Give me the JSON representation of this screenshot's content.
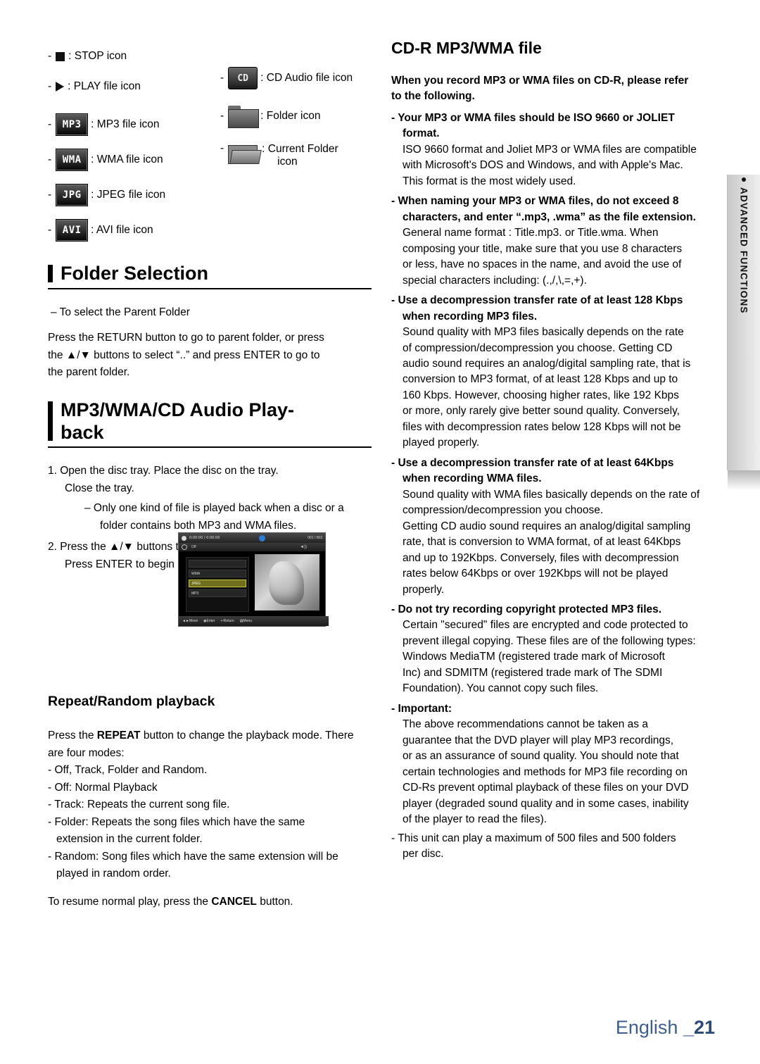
{
  "legend": {
    "items": [
      {
        "id": "stop",
        "icon": "stop-square-icon",
        "label": ": STOP icon"
      },
      {
        "id": "play",
        "icon": "play-triangle-icon",
        "label": ": PLAY file icon"
      },
      {
        "id": "mp3",
        "icon": "mp3-file-icon",
        "icon_text": "MP3",
        "label": ": MP3 file icon"
      },
      {
        "id": "wma",
        "icon": "wma-file-icon",
        "icon_text": "WMA",
        "label": ": WMA file icon"
      },
      {
        "id": "jpeg",
        "icon": "jpeg-file-icon",
        "icon_text": "JPG",
        "label": ": JPEG file icon"
      },
      {
        "id": "avi",
        "icon": "avi-file-icon",
        "icon_text": "AVI",
        "label": ": AVI file icon"
      },
      {
        "id": "cd",
        "icon": "cd-audio-file-icon",
        "icon_text": "CD",
        "label": ": CD Audio file icon"
      },
      {
        "id": "folder",
        "icon": "folder-icon",
        "label": ": Folder icon"
      },
      {
        "id": "current-folder",
        "icon": "current-folder-icon",
        "label": ": Current Folder",
        "label2": "icon"
      }
    ]
  },
  "folder_selection": {
    "title": "Folder Selection",
    "bullet": "–  To select the Parent Folder",
    "para_line1": "Press the RETURN button to go to parent folder, or press",
    "para_line2_a": "the ",
    "para_line2_b": " buttons to select “..” and press ENTER to go to",
    "para_line3": "the parent folder."
  },
  "playback": {
    "title_line1": "MP3/WMA/CD Audio Play-",
    "title_line2": "back",
    "step1_line1": "1.  Open the disc tray. Place the disc on the tray.",
    "step1_line2": "Close the tray.",
    "sub1_line1": "–   Only one kind of file is played back when a disc or a",
    "sub1_line2": "folder contains both MP3 and WMA files.",
    "step2_a": "2.  Press the ",
    "step2_b": " buttons to select a song file.",
    "step2_sub": "Press ENTER to begin playback of the song file."
  },
  "osd": {
    "time": "0:00:00 / 0:00:00",
    "track": "001 / 003",
    "off_label": "Off",
    "items": [
      "",
      "WMA",
      "JPEG",
      "MP3"
    ],
    "selected_index": 2,
    "footer": [
      "Move",
      "Enter",
      "Return",
      "Menu"
    ]
  },
  "repeat": {
    "title": "Repeat/Random playback",
    "p1_a": "Press the ",
    "p1_bold": "REPEAT",
    "p1_b": " button to change the playback mode. There",
    "p1_line2": "are four modes:",
    "modes": [
      "- Off, Track, Folder and Random.",
      "- Off: Normal Playback",
      "- Track: Repeats the current song file.",
      "- Folder: Repeats the song files which have the same",
      "extension in the current folder.",
      "- Random: Song files which have the same extension will be",
      "played in random order."
    ],
    "resume_a": "To resume normal play, press the ",
    "resume_bold": "CANCEL",
    "resume_b": " button."
  },
  "cdr": {
    "title": "CD-R MP3/WMA file",
    "intro_line1": "When you record MP3 or WMA files on CD-R, please refer",
    "intro_line2": "to the following.",
    "b1_line1": "- Your MP3 or WMA files should be ISO 9660 or JOLIET",
    "b1_line2": "format.",
    "b1_body": [
      "ISO 9660 format and Joliet MP3 or WMA files are compatible",
      "with Microsoft's DOS and Windows, and with Apple's Mac.",
      "This format is the most widely used."
    ],
    "b2_line1": "- When naming your MP3 or WMA files, do not exceed 8",
    "b2_line2": "characters, and enter “.mp3, .wma” as the file extension.",
    "b2_body": [
      "General name format : Title.mp3. or Title.wma. When",
      "composing your title, make sure that you use 8 characters",
      "or   less, have no spaces in the name, and avoid the use of",
      "special characters including: (.,/,\\,=,+)."
    ],
    "b3_line1": "- Use a decompression transfer rate of at least 128 Kbps",
    "b3_line2": "when recording MP3 files.",
    "b3_body": [
      "Sound quality with MP3 files basically depends on the rate",
      "of   compression/decompression you choose. Getting CD",
      "audio   sound requires an analog/digital sampling rate, that is",
      "conversion to MP3 format, of at least 128 Kbps and up to",
      "160   Kbps. However, choosing higher rates, like 192 Kbps",
      "or more,   only rarely give better sound quality. Conversely,",
      "files with   decompression rates below 128 Kbps will not be",
      "played     properly."
    ],
    "b4_line1": "- Use a decompression transfer rate of at least 64Kbps",
    "b4_line2": "when recording WMA files.",
    "b4_body": [
      "Sound quality with WMA files basically depends on the rate of",
      "compression/decompression you choose.",
      "Getting CD audio sound requires an analog/digital sampling",
      "rate, that is conversion to WMA format, of at least 64Kbps",
      "and up to 192Kbps. Conversely, files with decompression",
      "rates below 64Kbps or over 192Kbps will not be played",
      "properly."
    ],
    "b5_line1": "- Do not try recording copyright protected MP3 files.",
    "b5_body": [
      "Certain \"secured\" files are encrypted and code protected to",
      "prevent illegal copying. These files are of the following types:",
      "Windows MediaTM (registered trade mark of Microsoft",
      "Inc) and   SDMITM (registered trade mark of The SDMI",
      "Foundation). You cannot copy such files."
    ],
    "important_label": "- Important:",
    "important_body": [
      "The above recommendations cannot be taken as a",
      "guarantee that the DVD player will play MP3 recordings,",
      "or as an assurance of sound quality. You should note that",
      "certain technologies and methods for MP3 file recording on",
      "CD-Rs prevent optimal playback of these files on your DVD",
      "player (degraded sound quality and in some cases, inability",
      "of the player to read the files)."
    ],
    "last_line1": "- This unit can play a maximum of 500 files and 500 folders",
    "last_line2": "per disc."
  },
  "side_tab": {
    "label": "ADVANCED FUNCTIONS"
  },
  "footer": {
    "language": "English ",
    "page": "_21"
  }
}
